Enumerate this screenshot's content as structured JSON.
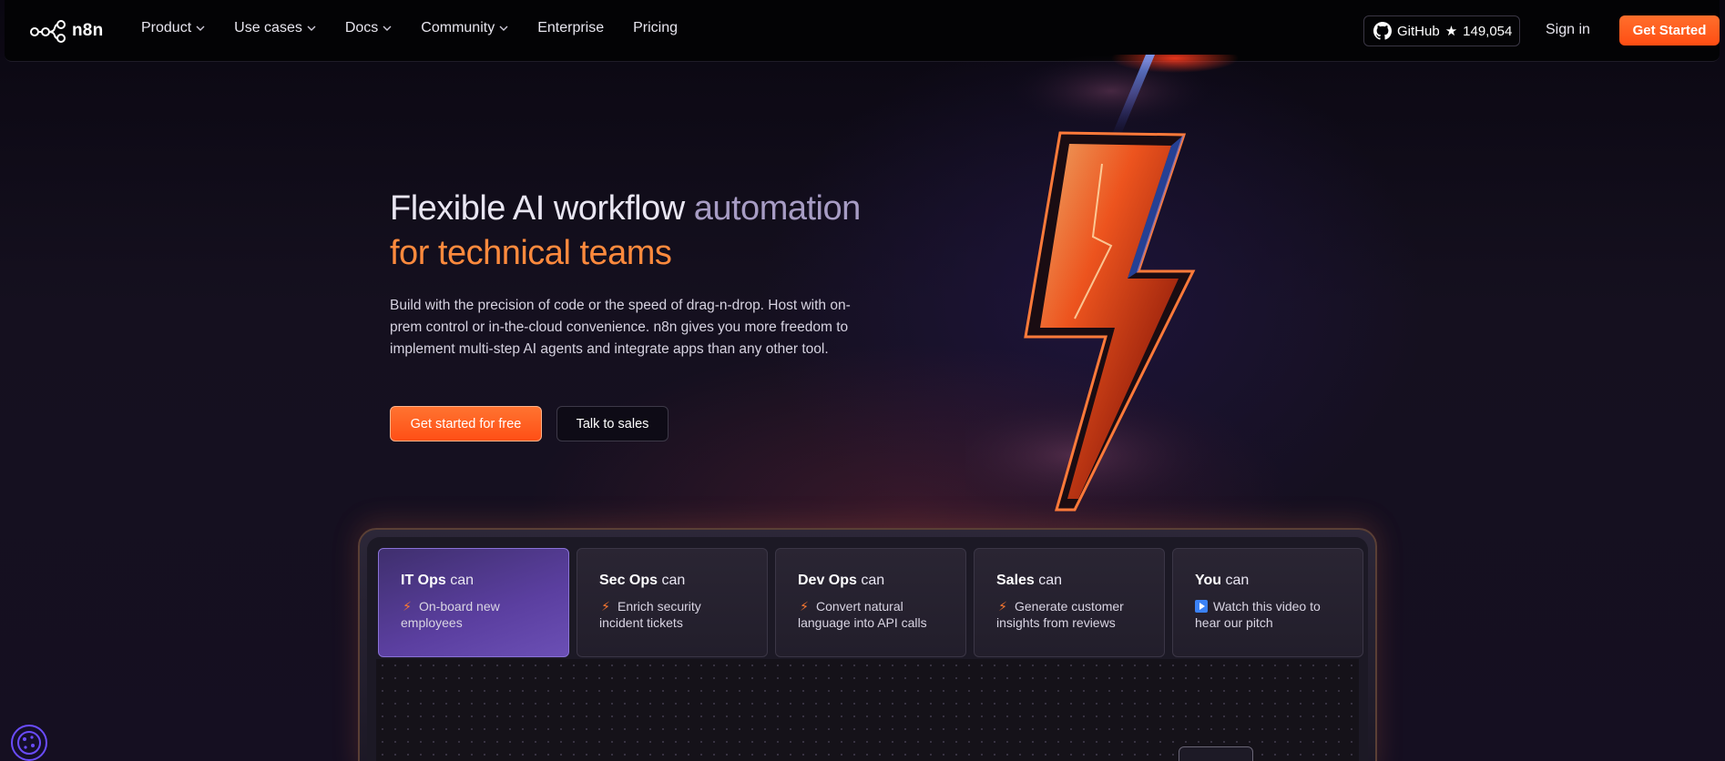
{
  "brand": {
    "name": "n8n"
  },
  "nav": {
    "items": [
      {
        "label": "Product",
        "dropdown": true
      },
      {
        "label": "Use cases",
        "dropdown": true
      },
      {
        "label": "Docs",
        "dropdown": true
      },
      {
        "label": "Community",
        "dropdown": true
      },
      {
        "label": "Enterprise",
        "dropdown": false
      },
      {
        "label": "Pricing",
        "dropdown": false
      }
    ],
    "github_label": "GitHub",
    "github_stars": "149,054",
    "signin": "Sign in",
    "get_started": "Get Started"
  },
  "hero": {
    "title_part1": "Flexible AI workflow ",
    "title_part2": "automation",
    "title_line2": "for technical teams",
    "description": "Build with the precision of code or the speed of drag-n-drop. Host with on-prem control or in-the-cloud convenience. n8n gives you more freedom to implement multi-step AI agents and integrate apps than any other tool.",
    "cta_primary": "Get started for free",
    "cta_secondary": "Talk to sales"
  },
  "cards": [
    {
      "role": "IT Ops",
      "suffix": " can",
      "icon": "bolt-icon",
      "text": "On-board new employees",
      "active": true
    },
    {
      "role": "Sec Ops",
      "suffix": " can",
      "icon": "bolt-icon",
      "text": "Enrich security incident tickets",
      "active": false
    },
    {
      "role": "Dev Ops",
      "suffix": " can",
      "icon": "bolt-icon",
      "text": "Convert natural language into API calls",
      "active": false
    },
    {
      "role": "Sales",
      "suffix": " can",
      "icon": "bolt-icon",
      "text": "Generate customer insights from reviews",
      "active": false
    },
    {
      "role": "You",
      "suffix": " can",
      "icon": "play-icon",
      "text": "Watch this video to hear our pitch",
      "active": false
    }
  ],
  "colors": {
    "accent": "#ff5a1f",
    "title_orange": "#ff8a3d",
    "title_purple": "#a79cc4",
    "active_card": "#5b3fa0",
    "background": "#130f1f"
  }
}
